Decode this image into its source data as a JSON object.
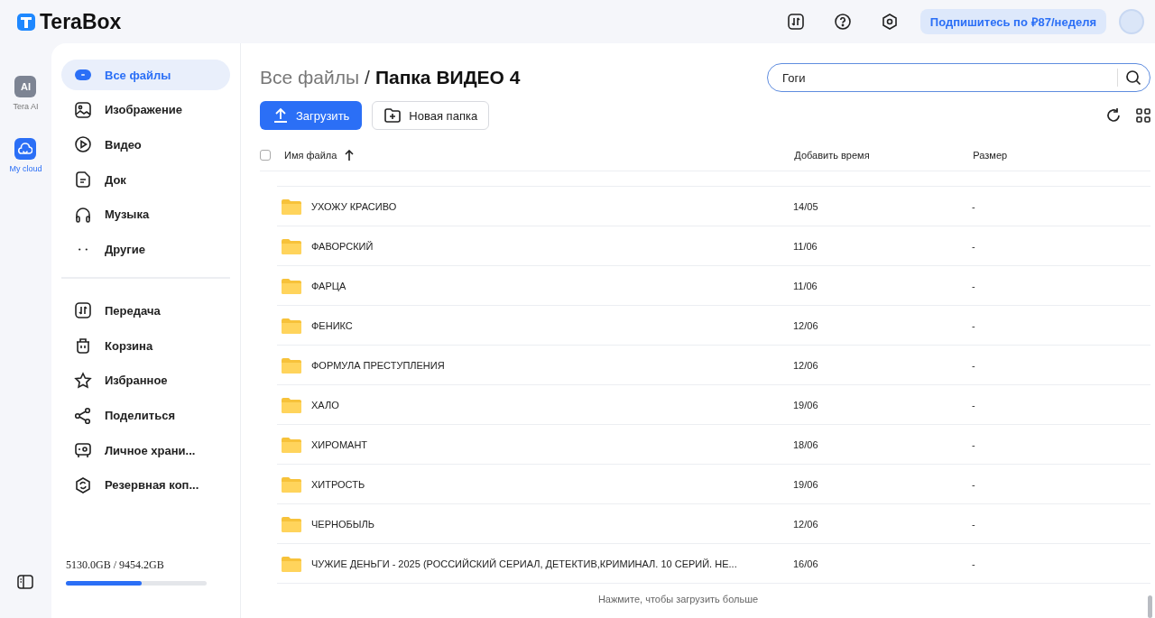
{
  "top_bar": {
    "logo": "TeraBox",
    "subscribe": "Подпишитесь по ₽87/неделя"
  },
  "rail": [
    {
      "kind": "ai",
      "badge": "AI",
      "label": "Tera AI",
      "selected": false
    },
    {
      "kind": "cloud",
      "label": "My cloud",
      "selected": true
    }
  ],
  "sidebar": {
    "categories": [
      {
        "kind": "all",
        "label": "Все файлы",
        "selected": true
      },
      {
        "kind": "image",
        "label": "Изображение",
        "selected": false
      },
      {
        "kind": "video",
        "label": "Видео",
        "selected": false
      },
      {
        "kind": "doc",
        "label": "Док",
        "selected": false
      },
      {
        "kind": "music",
        "label": "Музыка",
        "selected": false
      },
      {
        "kind": "other",
        "label": "Другие",
        "selected": false
      }
    ],
    "tools": [
      {
        "kind": "transfer",
        "label": "Передача"
      },
      {
        "kind": "trash",
        "label": "Корзина"
      },
      {
        "kind": "star",
        "label": "Избранное"
      },
      {
        "kind": "share",
        "label": "Поделиться"
      },
      {
        "kind": "safe",
        "label": "Личное храни..."
      },
      {
        "kind": "backup",
        "label": "Резервная коп..."
      }
    ],
    "storage": {
      "text": "5130.0GB / 9454.2GB",
      "level": 0.54
    }
  },
  "breadcrumb": {
    "parent": "Все файлы",
    "separator": "/",
    "current": "Папка ВИДЕО 4"
  },
  "search": {
    "value": "Гоги"
  },
  "buttons": {
    "upload": "Загрузить",
    "new_folder": "Новая папка"
  },
  "table": {
    "select_all_checked": false,
    "columns": [
      "Имя файла",
      "Добавить время",
      "Размер"
    ],
    "rows": [
      {
        "name": "УХОЖУ КРАСИВО",
        "date": "14/05",
        "size": "-"
      },
      {
        "name": "ФАВОРСКИЙ",
        "date": "11/06",
        "size": "-"
      },
      {
        "name": "ФАРЦА",
        "date": "11/06",
        "size": "-"
      },
      {
        "name": "ФЕНИКС",
        "date": "12/06",
        "size": "-"
      },
      {
        "name": "ФОРМУЛА ПРЕСТУПЛЕНИЯ",
        "date": "12/06",
        "size": "-"
      },
      {
        "name": "ХАЛО",
        "date": "19/06",
        "size": "-"
      },
      {
        "name": "ХИРОМАНТ",
        "date": "18/06",
        "size": "-"
      },
      {
        "name": "ХИТРОСТЬ",
        "date": "19/06",
        "size": "-"
      },
      {
        "name": "ЧЕРНОБЫЛЬ",
        "date": "12/06",
        "size": "-"
      },
      {
        "name": "ЧУЖИЕ ДЕНЬГИ - 2025 (РОССИЙСКИЙ СЕРИАЛ, ДЕТЕКТИВ,КРИМИНАЛ. 10 СЕРИЙ. НЕ...",
        "date": "16/06",
        "size": "-"
      }
    ]
  },
  "load_more": "Нажмите, чтобы загрузить больше"
}
